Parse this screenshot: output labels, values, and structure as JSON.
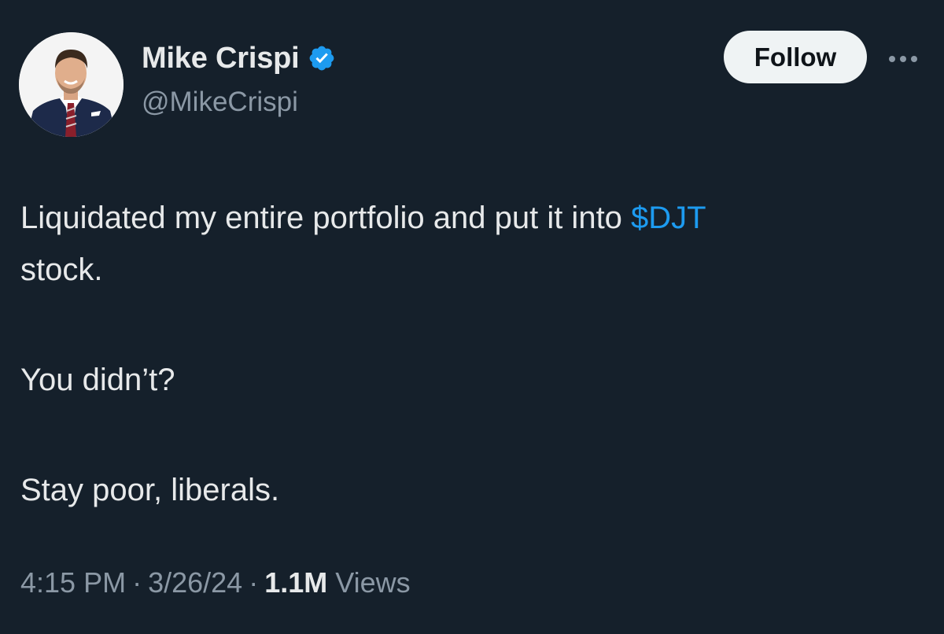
{
  "author": {
    "display_name": "Mike Crispi",
    "handle": "@MikeCrispi",
    "verified": true,
    "avatar": "avatar-photo"
  },
  "actions": {
    "follow_label": "Follow",
    "more_icon": "more-horizontal-icon"
  },
  "tweet": {
    "line1_text": "Liquidated my entire portfolio and put it into ",
    "cashtag": "$DJT",
    "line2_text": "stock.",
    "line3_text": "You didn’t?",
    "line4_text": "Stay poor, liberals."
  },
  "meta": {
    "time": "4:15 PM",
    "date": "3/26/24",
    "separator": "·",
    "views_count": "1.1M",
    "views_label": "Views"
  },
  "colors": {
    "background": "#15202b",
    "text": "#e7e9ea",
    "secondary": "#8b98a5",
    "accent": "#1d9bf0",
    "follow_bg": "#eff3f4"
  }
}
